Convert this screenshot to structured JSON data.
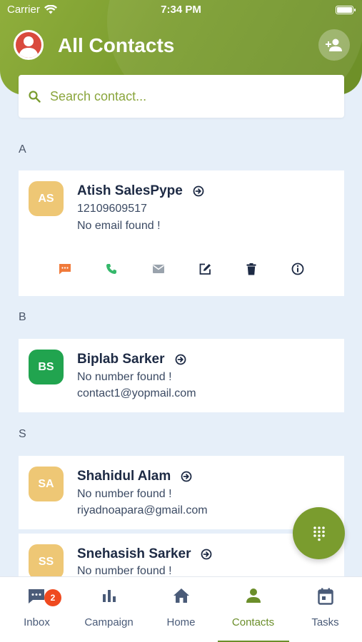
{
  "status_bar": {
    "carrier": "Carrier",
    "time": "7:34 PM"
  },
  "header": {
    "title": "All Contacts"
  },
  "search": {
    "placeholder": "Search contact..."
  },
  "sections": [
    {
      "letter": "A",
      "contacts": [
        {
          "initials": "AS",
          "name": "Atish SalesPype",
          "phone": "12109609517",
          "email": "No email found !",
          "avatar_color": "#eec775"
        }
      ]
    },
    {
      "letter": "B",
      "contacts": [
        {
          "initials": "BS",
          "name": "Biplab Sarker",
          "phone": "No number found !",
          "email": "contact1@yopmail.com",
          "avatar_color": "#21a44f"
        }
      ]
    },
    {
      "letter": "S",
      "contacts": [
        {
          "initials": "SA",
          "name": "Shahidul Alam",
          "phone": "No number found !",
          "email": "riyadnoapara@gmail.com",
          "avatar_color": "#eec775"
        },
        {
          "initials": "SS",
          "name": "Snehasish Sarker",
          "phone": "No number found !",
          "email": "",
          "avatar_color": "#eec775"
        }
      ]
    }
  ],
  "contact_actions": [
    {
      "icon": "message-icon",
      "color": "#f07a3a"
    },
    {
      "icon": "phone-icon",
      "color": "#35b86b"
    },
    {
      "icon": "mail-icon",
      "color": "#9aa3ad"
    },
    {
      "icon": "edit-icon",
      "color": "#1d2a44"
    },
    {
      "icon": "delete-icon",
      "color": "#1d2a44"
    },
    {
      "icon": "info-icon",
      "color": "#1d2a44"
    }
  ],
  "bottom_nav": {
    "items": [
      {
        "label": "Inbox",
        "icon": "inbox-icon",
        "badge": "2"
      },
      {
        "label": "Campaign",
        "icon": "bar-chart-icon"
      },
      {
        "label": "Home",
        "icon": "home-icon"
      },
      {
        "label": "Contacts",
        "icon": "person-icon",
        "active": true
      },
      {
        "label": "Tasks",
        "icon": "calendar-icon"
      }
    ]
  },
  "colors": {
    "brand": "#7a9c2e",
    "background": "#e6eff9",
    "badge": "#ef4a1f"
  }
}
